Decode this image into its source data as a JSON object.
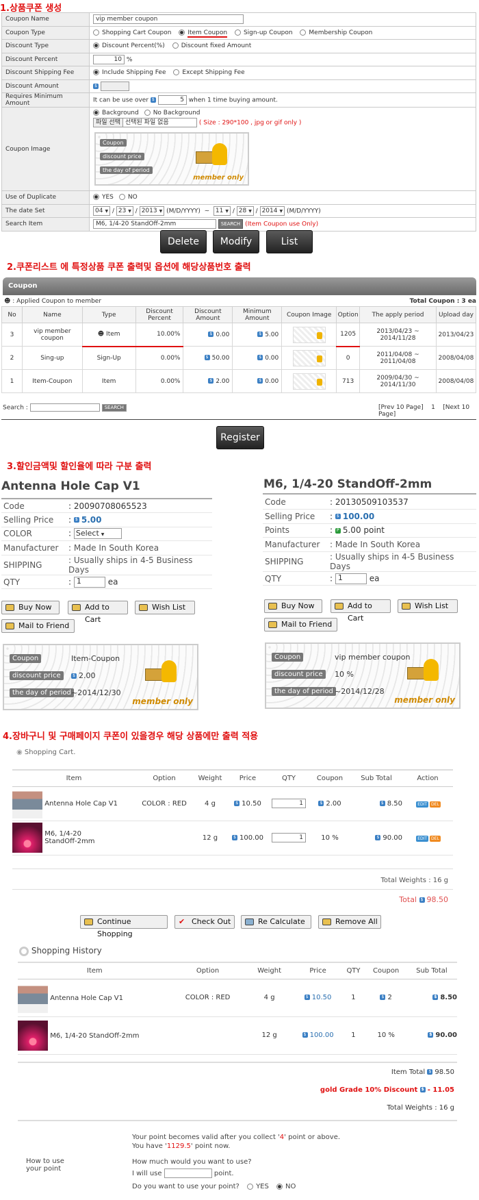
{
  "section1": {
    "title": "1.상품쿠폰 생성",
    "rows": {
      "name_label": "Coupon Name",
      "name_value": "vip member coupon",
      "type_label": "Coupon Type",
      "type_opts": [
        "Shopping Cart Coupon",
        "Item Coupon",
        "Sign-up Coupon",
        "Membership Coupon"
      ],
      "dtype_label": "Discount Type",
      "dtype_opts": [
        "Discount Percent(%)",
        "Discount fixed Amount"
      ],
      "dpercent_label": "Discount Percent",
      "dpercent_value": "10",
      "dpercent_unit": "%",
      "dship_label": "Discount Shipping Fee",
      "dship_opts": [
        "Include Shipping Fee",
        "Except Shipping Fee"
      ],
      "damount_label": "Discount Amount",
      "minamt_label": "Requires Minimum Amount",
      "minamt_pre": "It can be use over",
      "minamt_value": "5",
      "minamt_post": "when 1 time buying amount.",
      "image_label": "Coupon Image",
      "bg_opts": [
        "Background",
        "No Background"
      ],
      "file_btn": "파일 선택",
      "file_status": "선택된 파일 없음",
      "file_note": "( Size : 290*100 , jpg or gif only )",
      "preview": {
        "l1": "Coupon",
        "l2": "discount price",
        "l3": "the day of period",
        "member": "member only"
      },
      "dup_label": "Use of Duplicate",
      "dup_opts": [
        "YES",
        "NO"
      ],
      "date_label": "The date Set",
      "date_from": [
        "04",
        "23",
        "2013"
      ],
      "date_to": [
        "11",
        "28",
        "2014"
      ],
      "date_fmt": "(M/D/YYYY)",
      "date_sep": "~",
      "search_label": "Search Item",
      "search_value": "M6, 1/4-20 StandOff-2mm",
      "search_btn": "SEARCH",
      "search_note": "(Item Coupon use Only)"
    },
    "buttons": [
      "Delete",
      "Modify",
      "List"
    ]
  },
  "section2": {
    "title": "2.쿠폰리스트 에 특정상품 쿠폰 출력및 옵션에 해당상품번호 출력",
    "bar": "Coupon",
    "applied": ": Applied Coupon to member",
    "total": "Total Coupon : 3 ea",
    "headers": [
      "No",
      "Name",
      "Type",
      "Discount Percent",
      "Discount Amount",
      "Minimum Amount",
      "Coupon Image",
      "Option",
      "The apply period",
      "Upload day"
    ],
    "rows": [
      {
        "no": "3",
        "name": "vip member coupon",
        "type": "Item",
        "pct": "10.00%",
        "amt": "0.00",
        "min": "5.00",
        "opt": "1205",
        "period": "2013/04/23 ~ 2014/11/28",
        "up": "2013/04/23"
      },
      {
        "no": "2",
        "name": "Sing-up",
        "type": "Sign-Up",
        "pct": "0.00%",
        "amt": "50.00",
        "min": "0.00",
        "opt": "0",
        "period": "2011/04/08 ~ 2011/04/08",
        "up": "2008/04/08"
      },
      {
        "no": "1",
        "name": "Item-Coupon",
        "type": "Item",
        "pct": "0.00%",
        "amt": "2.00",
        "min": "0.00",
        "opt": "713",
        "period": "2009/04/30 ~ 2014/11/30",
        "up": "2008/04/08"
      }
    ],
    "search_label": "Search :",
    "search_btn": "SEARCH",
    "pager": {
      "prev": "[Prev 10 Page]",
      "cur": "1",
      "next": "[Next 10 Page]"
    },
    "register": "Register"
  },
  "section3": {
    "title": "3.할인금액및 할인율에 따라 구분 출력",
    "left": {
      "name": "Antenna Hole Cap V1",
      "rows": [
        [
          "Code",
          ": 20090708065523"
        ],
        [
          "Selling Price",
          "5.00"
        ],
        [
          "COLOR",
          "Select"
        ],
        [
          "Manufacturer",
          ": Made In South Korea"
        ],
        [
          "SHIPPING",
          ": Usually ships in 4-5 Business Days"
        ],
        [
          "QTY",
          "1"
        ]
      ],
      "qty_unit": "ea",
      "coupon": {
        "l1": "Coupon",
        "v1": "Item-Coupon",
        "l2": "discount price",
        "v2": "2.00",
        "l3": "the day of period",
        "v3": "~2014/12/30",
        "member": "member only"
      }
    },
    "right": {
      "name": "M6, 1/4-20 StandOff-2mm",
      "rows": [
        [
          "Code",
          ": 20130509103537"
        ],
        [
          "Selling Price",
          "100.00"
        ],
        [
          "Points",
          "5.00 point"
        ],
        [
          "Manufacturer",
          ": Made In South Korea"
        ],
        [
          "SHIPPING",
          ": Usually ships in 4-5 Business Days"
        ],
        [
          "QTY",
          "1"
        ]
      ],
      "qty_unit": "ea",
      "coupon": {
        "l1": "Coupon",
        "v1": "vip member coupon",
        "l2": "discount price",
        "v2": "10 %",
        "l3": "the day of period",
        "v3": "~2014/12/28",
        "member": "member only"
      }
    },
    "buttons": {
      "buy": "Buy Now",
      "cart": "Add to Cart",
      "wish": "Wish List",
      "mail": "Mail to Friend"
    }
  },
  "section4": {
    "title": "4.장바구니 및 구매페이지 쿠폰이 있을경우 해당 상품에만 출력 적용",
    "cart_title": "Shopping Cart.",
    "cart_headers": [
      "Item",
      "Option",
      "Weight",
      "Price",
      "QTY",
      "Coupon",
      "Sub Total",
      "Action"
    ],
    "cart_rows": [
      {
        "name": "Antenna Hole Cap V1",
        "opt": "COLOR : RED",
        "w": "4 g",
        "price": "10.50",
        "qty": "1",
        "coupon": "2.00",
        "sub": "8.50"
      },
      {
        "name": "M6, 1/4-20 StandOff-2mm",
        "opt": "",
        "w": "12 g",
        "price": "100.00",
        "qty": "1",
        "coupon": "10 %",
        "sub": "90.00"
      }
    ],
    "edit": "EDIT",
    "del": "DEL",
    "total_weight": "Total Weights : 16 g",
    "total_label": "Total",
    "total_value": "98.50",
    "cart_buttons": [
      "Continue Shopping",
      "Check Out",
      "Re Calculate",
      "Remove All"
    ],
    "history_title": "Shopping History",
    "hist_headers": [
      "Item",
      "Option",
      "Weight",
      "Price",
      "QTY",
      "Coupon",
      "Sub Total"
    ],
    "hist_rows": [
      {
        "name": "Antenna Hole Cap V1",
        "opt": "COLOR : RED",
        "w": "4 g",
        "price": "10.50",
        "qty": "1",
        "coupon": "2",
        "sub": "8.50"
      },
      {
        "name": "M6, 1/4-20 StandOff-2mm",
        "opt": "",
        "w": "12 g",
        "price": "100.00",
        "qty": "1",
        "coupon": "10 %",
        "sub": "90.00"
      }
    ],
    "item_total_label": "Item Total",
    "item_total": "98.50",
    "grade_label": "gold Grade 10% Discount",
    "grade_value": "- 11.05",
    "hist_weight": "Total Weights : 16 g",
    "point": {
      "how": "How to use your point",
      "l1a": "Your point becomes valid after you collect '",
      "l1b": "4",
      "l1c": "' point or above.",
      "l2a": "You have '",
      "l2b": "1129.5",
      "l2c": "' point now.",
      "q": "How much would you want to use?",
      "use_pre": "I will use",
      "use_post": "point.",
      "q2": "Do you want to use your point?",
      "yes": "YES",
      "no": "NO"
    }
  }
}
